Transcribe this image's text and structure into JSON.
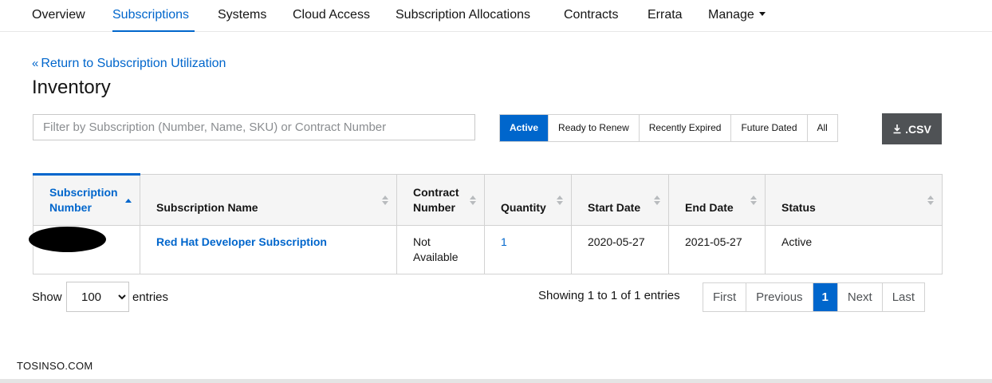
{
  "nav": {
    "tabs": [
      {
        "label": "Overview"
      },
      {
        "label": "Subscriptions"
      },
      {
        "label": "Systems"
      },
      {
        "label": "Cloud Access"
      },
      {
        "label": "Subscription Allocations"
      },
      {
        "label": "Contracts"
      },
      {
        "label": "Errata"
      },
      {
        "label": "Manage"
      }
    ],
    "active": "Subscriptions"
  },
  "header": {
    "back_link": "Return to Subscription Utilization",
    "title": "Inventory"
  },
  "filter": {
    "placeholder": "Filter by Subscription (Number, Name, SKU) or Contract Number",
    "value": "",
    "options": [
      "Active",
      "Ready to Renew",
      "Recently Expired",
      "Future Dated",
      "All"
    ],
    "selected": "Active"
  },
  "export": {
    "label": ".CSV",
    "icon": "download-icon"
  },
  "table": {
    "columns": [
      "Subscription Number",
      "Subscription Name",
      "Contract Number",
      "Quantity",
      "Start Date",
      "End Date",
      "Status"
    ],
    "sorted_column": "Subscription Number",
    "sort_direction": "ascending",
    "rows": [
      {
        "subscription_number": "",
        "subscription_name": "Red Hat Developer Subscription",
        "contract_number": "Not Available",
        "quantity": "1",
        "start_date": "2020-05-27",
        "end_date": "2021-05-27",
        "status": "Active"
      }
    ]
  },
  "footer": {
    "show_label": "Show",
    "page_size": "100",
    "entries_label": "entries",
    "showing": "Showing 1 to 1 of 1 entries",
    "pager": [
      "First",
      "Previous",
      "1",
      "Next",
      "Last"
    ],
    "current_page": "1"
  },
  "watermark": "TOSINSO.COM",
  "colors": {
    "accent": "#0066cc",
    "csv_button": "#4f5255",
    "header_bg": "#f5f5f5"
  }
}
